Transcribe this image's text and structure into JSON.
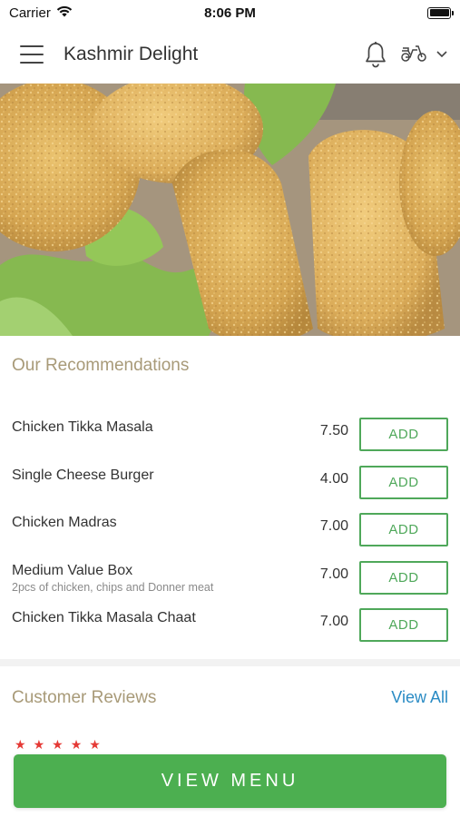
{
  "status": {
    "carrier": "Carrier",
    "time": "8:06 PM"
  },
  "header": {
    "title": "Kashmir Delight"
  },
  "recommendations": {
    "title": "Our Recommendations",
    "items": [
      {
        "name": "Chicken Tikka Masala",
        "description": "",
        "price": "7.50",
        "button": "ADD"
      },
      {
        "name": "Single Cheese Burger",
        "description": "",
        "price": "4.00",
        "button": "ADD"
      },
      {
        "name": "Chicken Madras",
        "description": "",
        "price": "7.00",
        "button": "ADD"
      },
      {
        "name": "Medium Value Box",
        "description": "2pcs of chicken, chips and Donner meat",
        "price": "7.00",
        "button": "ADD"
      },
      {
        "name": "Chicken Tikka Masala Chaat",
        "description": "",
        "price": "7.00",
        "button": "ADD"
      }
    ]
  },
  "reviews": {
    "title": "Customer Reviews",
    "view_all": "View All",
    "rating": 5
  },
  "footer": {
    "view_menu": "VIEW MENU"
  },
  "colors": {
    "accent_green": "#4caf50",
    "link_blue": "#2a8bc4",
    "section_title": "#a89a78",
    "star_red": "#e53935"
  }
}
